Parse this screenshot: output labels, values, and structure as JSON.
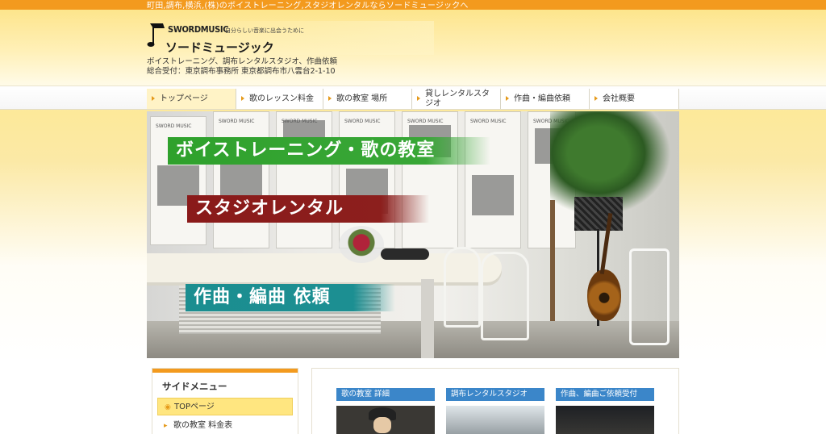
{
  "top_strip": "町田,調布,横浜,(株)のボイストレーニング,スタジオレンタルならソードミュージックへ",
  "header": {
    "brand": "SWORDMUSIC",
    "tagline": "自分らしい音楽に出会うために",
    "name": "ソードミュージック",
    "services": "ボイストレーニング、調布レンタルスタジオ、作曲依頼",
    "address": "総合受付：東京調布事務所 東京都調布市八雲台2-1-10"
  },
  "nav": {
    "items": [
      {
        "label": "トップページ"
      },
      {
        "label": "歌のレッスン料金"
      },
      {
        "label": "歌の教室 場所"
      },
      {
        "label": "貸しレンタルスタジオ"
      },
      {
        "label": "作曲・編曲依頼"
      },
      {
        "label": "会社概要"
      }
    ]
  },
  "hero": {
    "banner_voice": "ボイストレーニング・歌の教室",
    "banner_studio": "スタジオレンタル",
    "banner_compose": "作曲・編曲 依頼",
    "panel_text": "SWORD MUSIC"
  },
  "sidebar": {
    "title": "サイドメニュー",
    "items": [
      {
        "label": "TOPページ"
      },
      {
        "label": "歌の教室 料金表"
      }
    ]
  },
  "content": {
    "cards": [
      {
        "label": "歌の教室 詳細"
      },
      {
        "label": "調布レンタルスタジオ"
      },
      {
        "label": "作曲、編曲ご依頼受付"
      }
    ]
  },
  "colors": {
    "accent_orange": "#f39a1e",
    "banner_green": "#2fa12c",
    "banner_red": "#8a1a1a",
    "banner_teal": "#1b8e90",
    "card_blue": "#3b86c9"
  }
}
